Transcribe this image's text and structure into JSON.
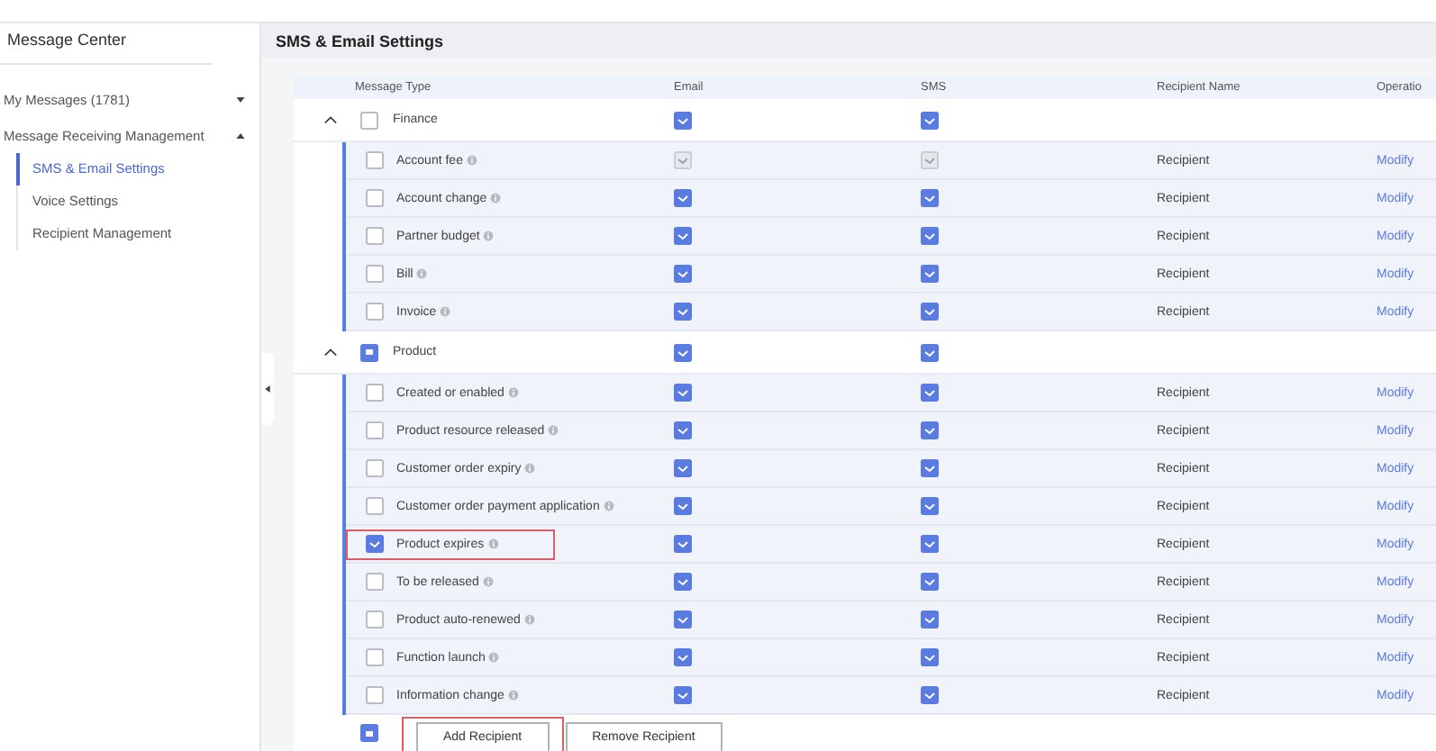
{
  "sidebar": {
    "title": "Message Center",
    "items": [
      {
        "label": "My Messages (1781)",
        "expanded": false
      },
      {
        "label": "Message Receiving Management",
        "expanded": true,
        "children": [
          {
            "label": "SMS & Email Settings",
            "selected": true
          },
          {
            "label": "Voice Settings",
            "selected": false
          },
          {
            "label": "Recipient Management",
            "selected": false
          }
        ]
      }
    ]
  },
  "page_title": "SMS & Email Settings",
  "table": {
    "columns": [
      "Message Type",
      "Email",
      "SMS",
      "Recipient Name",
      "Operatio"
    ],
    "groups": [
      {
        "name": "Finance",
        "expanded": true,
        "indeterminate": false,
        "email": {
          "checked": true,
          "disabled": false
        },
        "sms": {
          "checked": true,
          "disabled": false
        },
        "children": [
          {
            "name": "Account fee",
            "checked": false,
            "highlighted": false,
            "email": {
              "checked": true,
              "disabled": true
            },
            "sms": {
              "checked": true,
              "disabled": true
            },
            "recipient": "Recipient",
            "action": "Modify"
          },
          {
            "name": "Account change",
            "checked": false,
            "highlighted": false,
            "email": {
              "checked": true,
              "disabled": false
            },
            "sms": {
              "checked": true,
              "disabled": false
            },
            "recipient": "Recipient",
            "action": "Modify"
          },
          {
            "name": "Partner budget",
            "checked": false,
            "highlighted": false,
            "email": {
              "checked": true,
              "disabled": false
            },
            "sms": {
              "checked": true,
              "disabled": false
            },
            "recipient": "Recipient",
            "action": "Modify"
          },
          {
            "name": "Bill",
            "checked": false,
            "highlighted": false,
            "email": {
              "checked": true,
              "disabled": false
            },
            "sms": {
              "checked": true,
              "disabled": false
            },
            "recipient": "Recipient",
            "action": "Modify"
          },
          {
            "name": "Invoice",
            "checked": false,
            "highlighted": false,
            "email": {
              "checked": true,
              "disabled": false
            },
            "sms": {
              "checked": true,
              "disabled": false
            },
            "recipient": "Recipient",
            "action": "Modify"
          }
        ]
      },
      {
        "name": "Product",
        "expanded": true,
        "indeterminate": true,
        "email": {
          "checked": true,
          "disabled": false
        },
        "sms": {
          "checked": true,
          "disabled": false
        },
        "children": [
          {
            "name": "Created or enabled",
            "checked": false,
            "highlighted": false,
            "email": {
              "checked": true,
              "disabled": false
            },
            "sms": {
              "checked": true,
              "disabled": false
            },
            "recipient": "Recipient",
            "action": "Modify"
          },
          {
            "name": "Product resource released",
            "checked": false,
            "highlighted": false,
            "email": {
              "checked": true,
              "disabled": false
            },
            "sms": {
              "checked": true,
              "disabled": false
            },
            "recipient": "Recipient",
            "action": "Modify"
          },
          {
            "name": "Customer order expiry",
            "checked": false,
            "highlighted": false,
            "email": {
              "checked": true,
              "disabled": false
            },
            "sms": {
              "checked": true,
              "disabled": false
            },
            "recipient": "Recipient",
            "action": "Modify"
          },
          {
            "name": "Customer order payment application",
            "checked": false,
            "highlighted": false,
            "email": {
              "checked": true,
              "disabled": false
            },
            "sms": {
              "checked": true,
              "disabled": false
            },
            "recipient": "Recipient",
            "action": "Modify"
          },
          {
            "name": "Product expires",
            "checked": true,
            "highlighted": true,
            "email": {
              "checked": true,
              "disabled": false
            },
            "sms": {
              "checked": true,
              "disabled": false
            },
            "recipient": "Recipient",
            "action": "Modify"
          },
          {
            "name": "To be released",
            "checked": false,
            "highlighted": false,
            "email": {
              "checked": true,
              "disabled": false
            },
            "sms": {
              "checked": true,
              "disabled": false
            },
            "recipient": "Recipient",
            "action": "Modify"
          },
          {
            "name": "Product auto-renewed",
            "checked": false,
            "highlighted": false,
            "email": {
              "checked": true,
              "disabled": false
            },
            "sms": {
              "checked": true,
              "disabled": false
            },
            "recipient": "Recipient",
            "action": "Modify"
          },
          {
            "name": "Function launch",
            "checked": false,
            "highlighted": false,
            "email": {
              "checked": true,
              "disabled": false
            },
            "sms": {
              "checked": true,
              "disabled": false
            },
            "recipient": "Recipient",
            "action": "Modify"
          },
          {
            "name": "Information change",
            "checked": false,
            "highlighted": false,
            "email": {
              "checked": true,
              "disabled": false
            },
            "sms": {
              "checked": true,
              "disabled": false
            },
            "recipient": "Recipient",
            "action": "Modify"
          }
        ]
      }
    ]
  },
  "footer": {
    "indeterminate": true,
    "buttons": [
      {
        "label": "Add Recipient",
        "highlighted": true
      },
      {
        "label": "Remove Recipient",
        "highlighted": false
      }
    ]
  }
}
